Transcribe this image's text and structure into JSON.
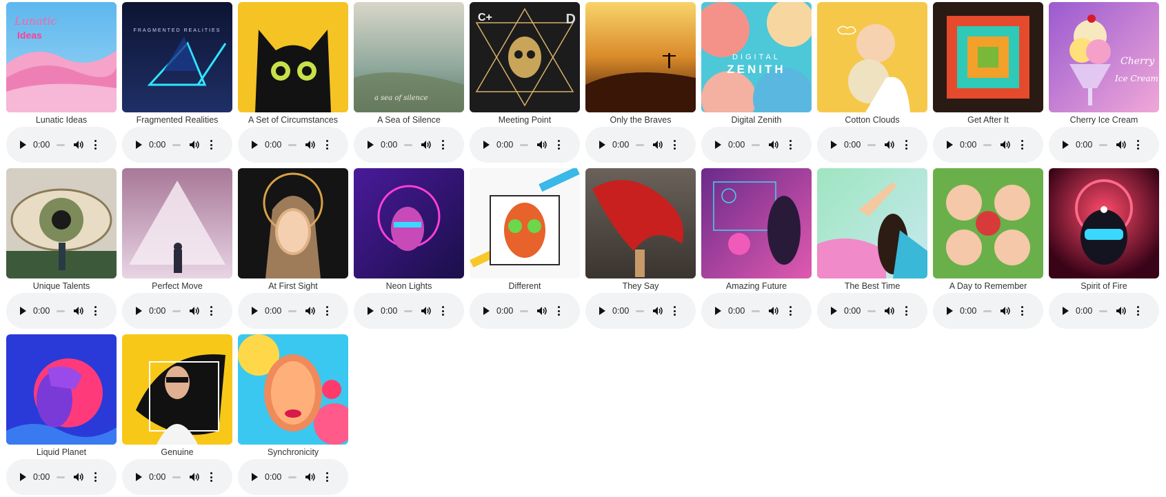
{
  "tracks": [
    {
      "title": "Lunatic Ideas",
      "time": "0:00",
      "cover": {
        "bg1": "#5db7ee",
        "bg2": "#f4a6c8",
        "accent": "#ff4fa0"
      }
    },
    {
      "title": "Fragmented Realities",
      "time": "0:00",
      "cover": {
        "bg1": "#0d1433",
        "bg2": "#1c2a5c",
        "accent": "#29e0ff"
      }
    },
    {
      "title": "A Set of Circumstances",
      "time": "0:00",
      "cover": {
        "bg1": "#f6c325",
        "bg2": "#f0b51a",
        "accent": "#121212"
      }
    },
    {
      "title": "A Sea of Silence",
      "time": "0:00",
      "cover": {
        "bg1": "#cfd3c4",
        "bg2": "#6f8f86",
        "accent": "#b58a62"
      }
    },
    {
      "title": "Meeting Point",
      "time": "0:00",
      "cover": {
        "bg1": "#1a1a1a",
        "bg2": "#2b2b2b",
        "accent": "#d8b26a"
      }
    },
    {
      "title": "Only the Braves",
      "time": "0:00",
      "cover": {
        "bg1": "#f3c04a",
        "bg2": "#6b2a0f",
        "accent": "#2a0f05"
      }
    },
    {
      "title": "Digital Zenith",
      "time": "0:00",
      "cover": {
        "bg1": "#3cc3d4",
        "bg2": "#f4928a",
        "accent": "#f7e6b0"
      }
    },
    {
      "title": "Cotton Clouds",
      "time": "0:00",
      "cover": {
        "bg1": "#f6c84a",
        "bg2": "#f2b93a",
        "accent": "#f1e3c8"
      }
    },
    {
      "title": "Get After It",
      "time": "0:00",
      "cover": {
        "bg1": "#2a1a14",
        "bg2": "#e64a2c",
        "accent": "#2fc9b8"
      }
    },
    {
      "title": "Cherry Ice Cream",
      "time": "0:00",
      "cover": {
        "bg1": "#b56ad6",
        "bg2": "#e6a0d8",
        "accent": "#ffe07a"
      }
    },
    {
      "title": "Unique Talents",
      "time": "0:00",
      "cover": {
        "bg1": "#d4cfc2",
        "bg2": "#3c5a3a",
        "accent": "#7d8a5a"
      }
    },
    {
      "title": "Perfect Move",
      "time": "0:00",
      "cover": {
        "bg1": "#b388a8",
        "bg2": "#e6cde0",
        "accent": "#f4eaf2"
      }
    },
    {
      "title": "At First Sight",
      "time": "0:00",
      "cover": {
        "bg1": "#121212",
        "bg2": "#1e1e1e",
        "accent": "#d9a145"
      }
    },
    {
      "title": "Neon Lights",
      "time": "0:00",
      "cover": {
        "bg1": "#3a1a7a",
        "bg2": "#1a0f4a",
        "accent": "#ff3fd6"
      }
    },
    {
      "title": "Different",
      "time": "0:00",
      "cover": {
        "bg1": "#fafafa",
        "bg2": "#f5f5f5",
        "accent": "#e8622b"
      }
    },
    {
      "title": "They Say",
      "time": "0:00",
      "cover": {
        "bg1": "#6a625a",
        "bg2": "#3a342f",
        "accent": "#c8201e"
      }
    },
    {
      "title": "Amazing Future",
      "time": "0:00",
      "cover": {
        "bg1": "#6a2a8a",
        "bg2": "#c84aa8",
        "accent": "#3ad8f0"
      }
    },
    {
      "title": "The Best Time",
      "time": "0:00",
      "cover": {
        "bg1": "#9ee6c0",
        "bg2": "#f08ac8",
        "accent": "#2c1c14"
      }
    },
    {
      "title": "A Day to Remember",
      "time": "0:00",
      "cover": {
        "bg1": "#6ab04a",
        "bg2": "#d83a3a",
        "accent": "#f4c8a8"
      }
    },
    {
      "title": "Spirit of Fire",
      "time": "0:00",
      "cover": {
        "bg1": "#5a0a2a",
        "bg2": "#ff3a5a",
        "accent": "#3ad8ff"
      }
    },
    {
      "title": "Liquid Planet",
      "time": "0:00",
      "cover": {
        "bg1": "#2a3ad8",
        "bg2": "#ff3a7a",
        "accent": "#7a3ad8"
      }
    },
    {
      "title": "Genuine",
      "time": "0:00",
      "cover": {
        "bg1": "#f8c818",
        "bg2": "#111111",
        "accent": "#f4f4f4"
      }
    },
    {
      "title": "Synchronicity",
      "time": "0:00",
      "cover": {
        "bg1": "#ff5a8a",
        "bg2": "#3ac8f0",
        "accent": "#ffd84a"
      }
    }
  ],
  "cover_text": {
    "lunatic": "Lunatic",
    "ideas": "Ideas",
    "fragmented": "FRAGMENTED REALITIES",
    "sea": "a sea of silence",
    "meeting_left": "C+",
    "meeting_right": "D",
    "digital": "DIGITAL",
    "zenith": "ZENITH",
    "cherry": "Cherry",
    "icecream": "Ice Cream"
  },
  "icons": {
    "play": "play-icon",
    "volume": "volume-icon",
    "more": "more-options-icon"
  }
}
